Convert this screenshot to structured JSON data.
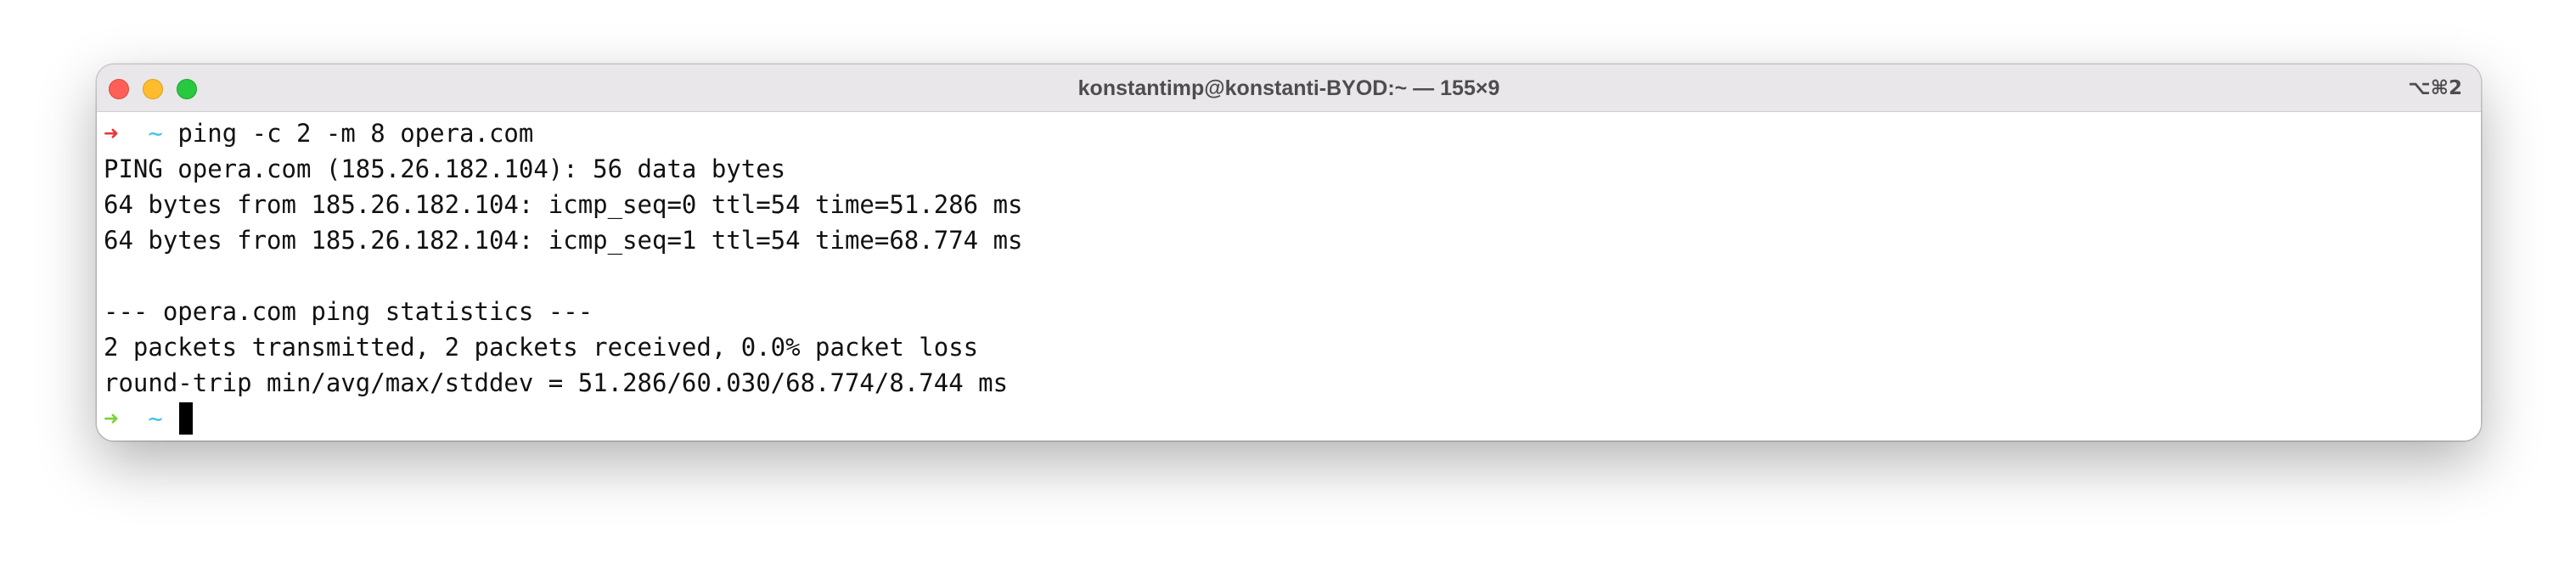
{
  "window": {
    "title": "konstantimp@konstanti-BYOD:~ — 155×9",
    "shortcut": "⌥⌘2",
    "traffic_lights": {
      "close_color": "#fe5f57",
      "minimize_color": "#febc2e",
      "maximize_color": "#28c840"
    }
  },
  "terminal": {
    "prompt": {
      "arrow_glyph": "➜",
      "cwd": "~",
      "error_arrow_color": "#e8363a",
      "ok_arrow_color": "#7fd13a",
      "cwd_color": "#3fc3e8"
    },
    "command": "ping -c 2 -m 8 opera.com",
    "output": [
      "PING opera.com (185.26.182.104): 56 data bytes",
      "64 bytes from 185.26.182.104: icmp_seq=0 ttl=54 time=51.286 ms",
      "64 bytes from 185.26.182.104: icmp_seq=1 ttl=54 time=68.774 ms",
      "",
      "--- opera.com ping statistics ---",
      "2 packets transmitted, 2 packets received, 0.0% packet loss",
      "round-trip min/avg/max/stddev = 51.286/60.030/68.774/8.744 ms"
    ]
  }
}
